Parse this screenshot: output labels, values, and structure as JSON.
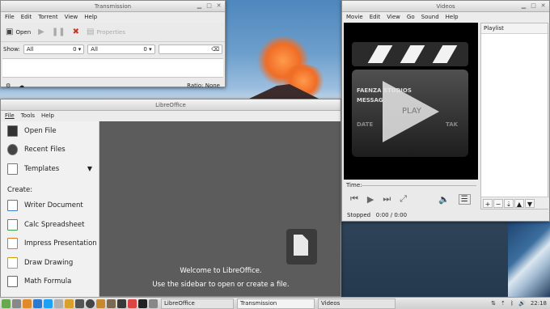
{
  "transmission": {
    "title": "Transmission",
    "menu": [
      "File",
      "Edit",
      "Torrent",
      "View",
      "Help"
    ],
    "toolbar": {
      "open_label": "Open",
      "properties_label": "Properties"
    },
    "filter": {
      "show_label": "Show:",
      "combo1_value": "All",
      "combo1_count": "0",
      "combo2_value": "All",
      "combo2_count": "0"
    },
    "status": {
      "ratio": "Ratio: None"
    }
  },
  "libreoffice": {
    "title": "LibreOffice",
    "menu": [
      "File",
      "Tools",
      "Help"
    ],
    "sidebar": {
      "open_file": "Open File",
      "recent_files": "Recent Files",
      "templates": "Templates",
      "create_label": "Create:",
      "items": [
        "Writer Document",
        "Calc Spreadsheet",
        "Impress Presentation",
        "Draw Drawing",
        "Math Formula"
      ]
    },
    "welcome": "Welcome to LibreOffice.",
    "hint": "Use the sidebar to open or create a file."
  },
  "videos": {
    "title": "Videos",
    "menu": [
      "Movie",
      "Edit",
      "View",
      "Go",
      "Sound",
      "Help"
    ],
    "poster": {
      "line1": "FAENZA STUDIOS",
      "line2": "MESSAG",
      "play": "PLAY",
      "date": "DATE",
      "take": "TAK"
    },
    "playlist_label": "Playlist",
    "time_label": "Time:",
    "status": "Stopped",
    "time_value": "0:00 / 0:00"
  },
  "taskbar": {
    "tasks": [
      "LibreOffice",
      "Transmission",
      "Videos"
    ],
    "clock": "22:18"
  }
}
